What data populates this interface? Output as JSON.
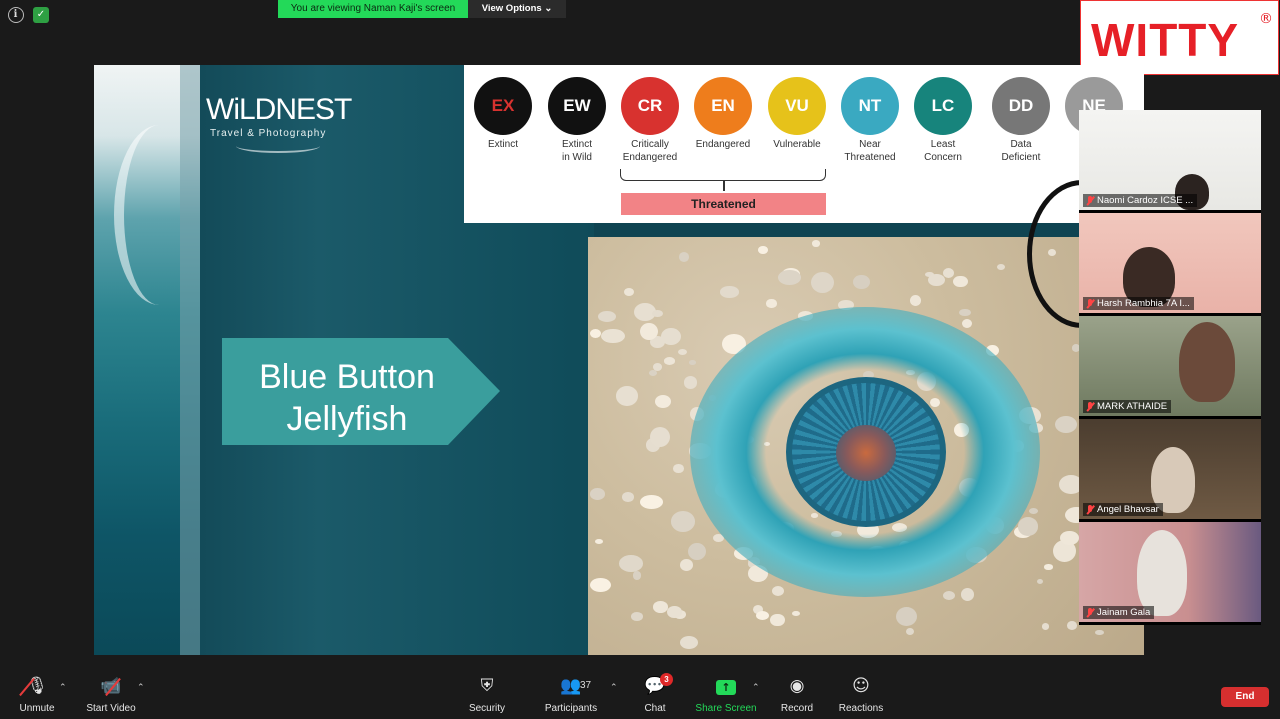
{
  "meeting": {
    "viewing_banner": "You are viewing Naman Kaji's screen",
    "view_options": "View Options ⌄"
  },
  "brand": {
    "word": "WITTY",
    "reg": "®"
  },
  "slide": {
    "logo_word": "WiLDNEST",
    "logo_sub": "Travel & Photography",
    "title_line1": "Blue Button",
    "title_line2": "Jellyfish",
    "categories": [
      {
        "code": "EX",
        "label": "Extinct",
        "color": "#111111",
        "text_color": "#d8322f"
      },
      {
        "code": "EW",
        "label": "Extinct\nin Wild",
        "color": "#111111",
        "text_color": "#ffffff"
      },
      {
        "code": "CR",
        "label": "Critically\nEndangered",
        "color": "#d8322f",
        "text_color": "#ffffff"
      },
      {
        "code": "EN",
        "label": "Endangered",
        "color": "#ee7d1c",
        "text_color": "#ffffff"
      },
      {
        "code": "VU",
        "label": "Vulnerable",
        "color": "#e6c21a",
        "text_color": "#ffffff"
      },
      {
        "code": "NT",
        "label": "Near\nThreatened",
        "color": "#3aa9c1",
        "text_color": "#ffffff"
      },
      {
        "code": "LC",
        "label": "Least\nConcern",
        "color": "#17847c",
        "text_color": "#ffffff"
      },
      {
        "code": "DD",
        "label": "Data\nDeficient",
        "color": "#777777",
        "text_color": "#ffffff"
      },
      {
        "code": "NE",
        "label": "",
        "color": "#9a9a9a",
        "text_color": "#ffffff"
      }
    ],
    "threatened_label": "Threatened"
  },
  "participants": [
    {
      "name": "Naomi Cardoz ICSE ..."
    },
    {
      "name": "Harsh Rambhia 7A I..."
    },
    {
      "name": "MARK ATHAIDE"
    },
    {
      "name": "Angel Bhavsar"
    },
    {
      "name": "Jainam Gala"
    }
  ],
  "toolbar": {
    "unmute": "Unmute",
    "start_video": "Start Video",
    "security": "Security",
    "participants": "Participants",
    "participant_count": "37",
    "chat": "Chat",
    "chat_badge": "3",
    "share_screen": "Share Screen",
    "record": "Record",
    "reactions": "Reactions",
    "end": "End"
  }
}
